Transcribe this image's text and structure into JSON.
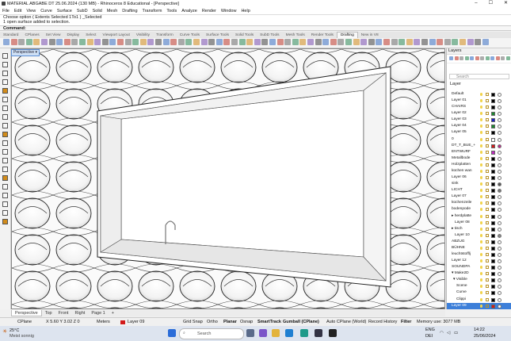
{
  "window": {
    "title": "MATERIAL ABGABE DT 25.06.2024 (130 MB) - Rhinoceros 8 Educational - [Perspective]",
    "controls": [
      "–",
      "☐",
      "✕"
    ]
  },
  "menu": [
    "File",
    "Edit",
    "View",
    "Curve",
    "Surface",
    "SubD",
    "Solid",
    "Mesh",
    "Drafting",
    "Transform",
    "Tools",
    "Analyze",
    "Render",
    "Window",
    "Help"
  ],
  "command_history": [
    "Choose option ( Extents  Selected  1To1 ) _Selected",
    "1 open surface added to selection."
  ],
  "command_prompt": "Command:",
  "toolbar_tabs": {
    "items": [
      "Standard",
      "CPlanes",
      "Set View",
      "Display",
      "Select",
      "Viewport Layout",
      "Visibility",
      "Transform",
      "Curve Tools",
      "Surface Tools",
      "Solid Tools",
      "SubD Tools",
      "Mesh Tools",
      "Render Tools",
      "Drafting",
      "New in V8"
    ],
    "active": "Drafting"
  },
  "viewport": {
    "label": "Perspective ▾"
  },
  "layers_panel": {
    "title": "Layers",
    "search_placeholder": "Search",
    "column_header": "Layer",
    "rows": [
      {
        "name": "Default",
        "color": "#000000",
        "material": "#ffffff",
        "indent": 0
      },
      {
        "name": "Layer 01",
        "color": "#000000",
        "material": "#ffffff",
        "indent": 0
      },
      {
        "name": "CHAIRS",
        "color": "#000000",
        "material": "#ffffff",
        "indent": 0
      },
      {
        "name": "Layer 02",
        "color": "#1c8a2e",
        "material": "#ffffff",
        "indent": 0
      },
      {
        "name": "Layer 03",
        "color": "#1a20c9",
        "material": "#ffffff",
        "indent": 0
      },
      {
        "name": "Layer 04",
        "color": "#1c8a2e",
        "material": "#ffffff",
        "indent": 0
      },
      {
        "name": "Layer 05",
        "color": "#000000",
        "material": "#ffffff",
        "indent": 0
      },
      {
        "name": "0",
        "color": "#ffffff",
        "material": "#ffffff",
        "indent": 0
      },
      {
        "name": "DT_T_BUE_+",
        "color": "#d21a1a",
        "material": "#c02a8a",
        "indent": 0
      },
      {
        "name": "ENTWURF",
        "color": "#c02ac0",
        "material": "#ffffff",
        "indent": 0
      },
      {
        "name": "Metallbode",
        "color": "#000000",
        "material": "#ffffff",
        "indent": 0
      },
      {
        "name": "Holzplatten",
        "color": "#000000",
        "material": "#ffffff",
        "indent": 0
      },
      {
        "name": "küchen wan",
        "color": "#000000",
        "material": "#ffffff",
        "indent": 0
      },
      {
        "name": "Layer 06",
        "color": "#000000",
        "material": "#ffffff",
        "indent": 0
      },
      {
        "name": "sink",
        "color": "#000000",
        "material": "#555555",
        "indent": 0
      },
      {
        "name": "LICHT",
        "color": "#000000",
        "material": "#777777",
        "indent": 0
      },
      {
        "name": "Layer 07",
        "color": "#000000",
        "material": "#ffffff",
        "indent": 0
      },
      {
        "name": "küchenzeile",
        "color": "#000000",
        "material": "#ffffff",
        "indent": 0
      },
      {
        "name": "bodenpode",
        "color": "#000000",
        "material": "#ffffff",
        "indent": 0
      },
      {
        "name": "▸ herdplatte",
        "color": "#000000",
        "material": "#ffffff",
        "indent": 0
      },
      {
        "name": "Layer 08",
        "color": "#000000",
        "material": "#ffffff",
        "indent": 2
      },
      {
        "name": "▸ tisch",
        "color": "#000000",
        "material": "#ffffff",
        "indent": 0
      },
      {
        "name": "Layer 10",
        "color": "#000000",
        "material": "#888888",
        "indent": 2
      },
      {
        "name": "ABZUG",
        "color": "#000000",
        "material": "#ffffff",
        "indent": 0
      },
      {
        "name": "BÜHNE",
        "color": "#000000",
        "material": "#ffffff",
        "indent": 0
      },
      {
        "name": "leuchtstofflj",
        "color": "#000000",
        "material": "#ffffff",
        "indent": 0
      },
      {
        "name": "Layer 12",
        "color": "#000000",
        "material": "#ffffff",
        "indent": 0
      },
      {
        "name": "SOUNDPA",
        "color": "#000000",
        "material": "#ffffff",
        "indent": 0
      },
      {
        "name": "▾ Make2D",
        "color": "#000000",
        "material": "#ffffff",
        "indent": 0
      },
      {
        "name": "▾ Visible",
        "color": "#000000",
        "material": "#ffffff",
        "indent": 1
      },
      {
        "name": "Scene",
        "color": "#000000",
        "material": "#ffffff",
        "indent": 3
      },
      {
        "name": "Curve",
        "color": "#000000",
        "material": "#ffffff",
        "indent": 3
      },
      {
        "name": "Clippi",
        "color": "#000000",
        "material": "#ffffff",
        "indent": 3
      },
      {
        "name": "Layer 09",
        "color": "#d21a1a",
        "material": "#ffffff",
        "indent": 0,
        "selected": true
      }
    ]
  },
  "viewport_tabs": {
    "items": [
      "Perspective",
      "Top",
      "Front",
      "Right",
      "Page 1",
      "+"
    ],
    "active": "Perspective"
  },
  "status": {
    "cplane": "CPlane",
    "coords": "X 5.60 Y 3.02 Z 0",
    "units": "Meters",
    "layer": "Layer 09",
    "layer_color": "#d21a1a",
    "grid_snap": "Grid Snap",
    "ortho": "Ortho",
    "planar": "Planar",
    "osnap": "Osnap",
    "smarttrack": "SmartTrack",
    "gumball": "Gumball (CPlane)",
    "autocplane": "Auto CPlane (World)",
    "record_history": "Record History",
    "filter": "Filter",
    "memory": "Memory use: 3077 MB"
  },
  "taskbar": {
    "weather_temp": "25°C",
    "weather_desc": "Meist sonnig",
    "search_placeholder": "Search",
    "lang1": "ENG",
    "lang2": "DEI",
    "time": "14:22",
    "date": "25/06/2024"
  }
}
